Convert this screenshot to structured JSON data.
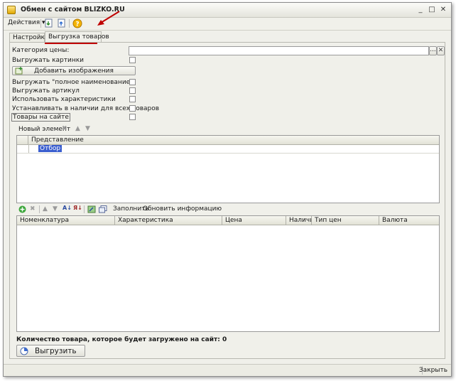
{
  "window": {
    "title": "Обмен с сайтом BLIZKO.RU"
  },
  "toolbar": {
    "actions_label": "Действия"
  },
  "tabs": [
    {
      "label": "Настройки"
    },
    {
      "label": "Выгрузка товаров"
    }
  ],
  "form": {
    "price_category_label": "Категория цены:",
    "price_category_value": "",
    "export_images_label": "Выгружать картинки",
    "add_images_button": "Добавить изображения",
    "full_name_label": "Выгружать \"полное наименование\"",
    "article_label": "Выгружать артикул",
    "characteristics_label": "Использовать характеристики",
    "set_availability_label": "Устанавливать в наличии для всех товаров",
    "goods_on_site_label": "Товары на сайте"
  },
  "filter": {
    "new_element_label": "Новый элемент",
    "column_header": "Представление",
    "row_label": "Отбор"
  },
  "goods": {
    "fill_label": "Заполнить",
    "refresh_label": "Обновить информацию",
    "columns": [
      "Номенклатура",
      "Характеристика",
      "Цена",
      "Наличие",
      "Тип цен",
      "Валюта"
    ]
  },
  "summary": {
    "count_label": "Количество товара, которое будет загружено на сайт: 0",
    "export_button": "Выгрузить"
  },
  "status": {
    "close_label": "Закрыть"
  },
  "colors": {
    "annotation": "#c00000",
    "selection": "#3b5fcf"
  }
}
